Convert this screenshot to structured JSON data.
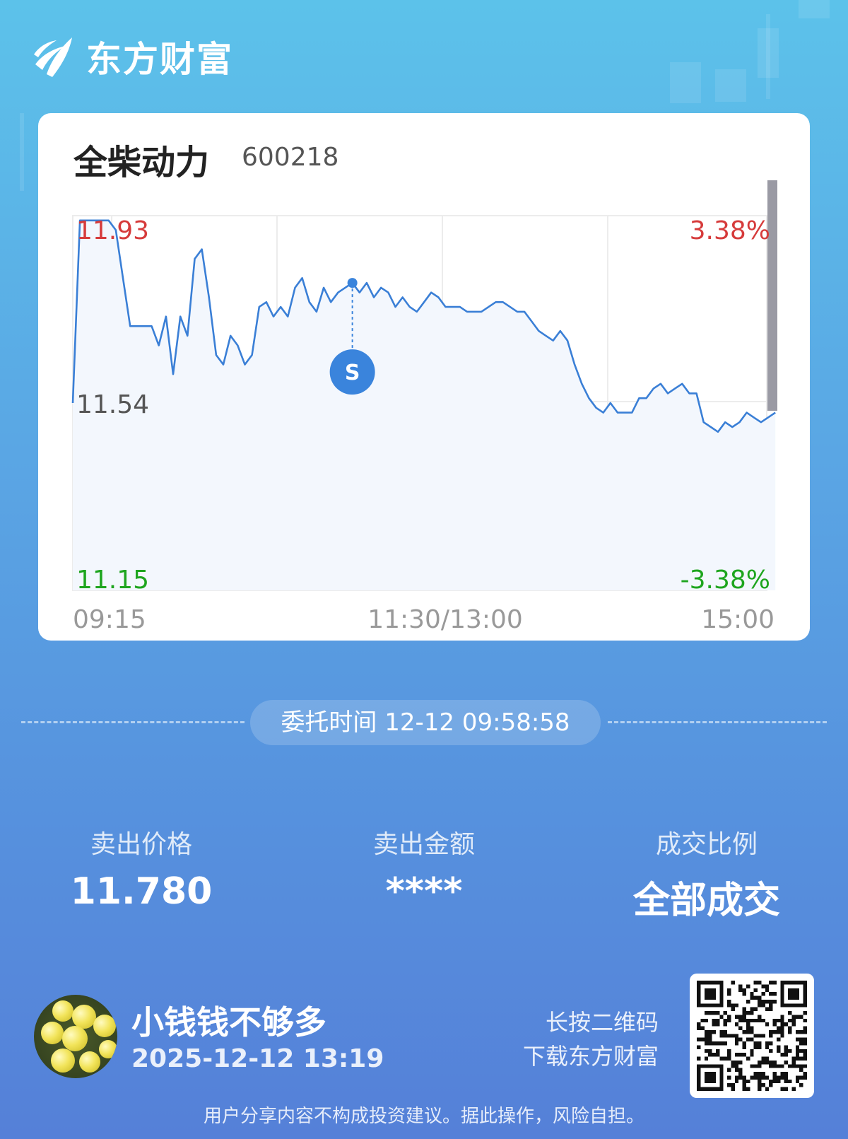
{
  "brand": {
    "name": "东方财富"
  },
  "stock": {
    "name": "全柴动力",
    "code": "600218"
  },
  "chart_data": {
    "type": "line",
    "series": [
      {
        "values": [
          11.54,
          11.92,
          11.92,
          11.92,
          11.92,
          11.92,
          11.9,
          11.8,
          11.7,
          11.7,
          11.7,
          11.7,
          11.66,
          11.72,
          11.6,
          11.72,
          11.68,
          11.84,
          11.86,
          11.76,
          11.64,
          11.62,
          11.68,
          11.66,
          11.62,
          11.64,
          11.74,
          11.75,
          11.72,
          11.74,
          11.72,
          11.78,
          11.8,
          11.75,
          11.73,
          11.78,
          11.75,
          11.77,
          11.78,
          11.79,
          11.77,
          11.79,
          11.76,
          11.78,
          11.77,
          11.74,
          11.76,
          11.74,
          11.73,
          11.75,
          11.77,
          11.76,
          11.74,
          11.74,
          11.74,
          11.73,
          11.73,
          11.73,
          11.74,
          11.75,
          11.75,
          11.74,
          11.73,
          11.73,
          11.71,
          11.69,
          11.68,
          11.67,
          11.69,
          11.67,
          11.62,
          11.58,
          11.55,
          11.53,
          11.52,
          11.54,
          11.52,
          11.52,
          11.52,
          11.55,
          11.55,
          11.57,
          11.58,
          11.56,
          11.57,
          11.58,
          11.56,
          11.56,
          11.5,
          11.49,
          11.48,
          11.5,
          11.49,
          11.5,
          11.52,
          11.51,
          11.5,
          11.51,
          11.52
        ]
      }
    ],
    "x_ticks": [
      "09:15",
      "11:30/13:00",
      "15:00"
    ],
    "y_left": {
      "high": "11.93",
      "mid": "11.54",
      "low": "11.15"
    },
    "y_right": {
      "high": "3.38%",
      "low": "-3.38%"
    },
    "ylim": [
      11.15,
      11.93
    ],
    "prev_close": 11.54,
    "marker": {
      "label": "S",
      "value": 11.79
    },
    "colors": {
      "line": "#3a7fd6",
      "fill": "#f3f7fd",
      "up": "#d63b3b",
      "down": "#1ea51e",
      "flat": "#555555",
      "marker": "#3a84dc"
    },
    "grid": true
  },
  "order": {
    "time_text": "委托时间 12-12 09:58:58"
  },
  "stats": [
    {
      "label": "卖出价格",
      "value": "11.780"
    },
    {
      "label": "卖出金额",
      "value": "****"
    },
    {
      "label": "成交比例",
      "value": "全部成交"
    }
  ],
  "user": {
    "name": "小钱钱不够多",
    "share_time": "2025-12-12 13:19"
  },
  "qr": {
    "hint_line1": "长按二维码",
    "hint_line2": "下载东方财富"
  },
  "disclaimer": "用户分享内容不构成投资建议。据此操作，风险自担。"
}
